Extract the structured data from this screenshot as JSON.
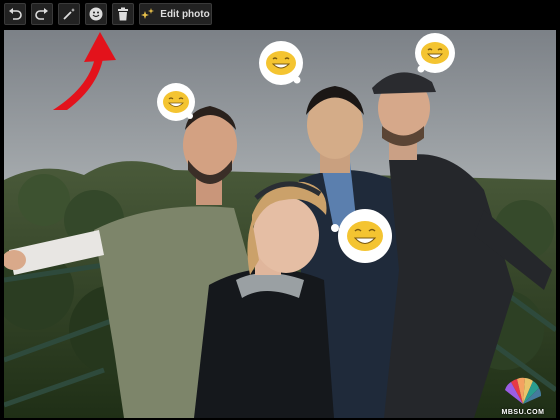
{
  "toolbar": {
    "undo": {
      "icon": "undo-icon"
    },
    "redo": {
      "icon": "redo-icon"
    },
    "magic": {
      "icon": "magic-wand-icon"
    },
    "emoji": {
      "icon": "smiley-icon"
    },
    "delete": {
      "icon": "trash-icon"
    },
    "edit": {
      "icon": "sparkle-icon",
      "label": "Edit photo"
    }
  },
  "colors": {
    "toolbar_bg": "#000000",
    "button_bg": "#222222",
    "arrow": "#e3121b",
    "sticker_face": "#f4c431",
    "sticker_bubble": "#ffffff"
  },
  "stickers": [
    {
      "icon": "grinning-face-sticker"
    },
    {
      "icon": "grinning-face-sticker"
    },
    {
      "icon": "grinning-face-sticker"
    },
    {
      "icon": "grinning-face-sticker"
    }
  ],
  "watermark": {
    "text": "MBSU.COM"
  }
}
